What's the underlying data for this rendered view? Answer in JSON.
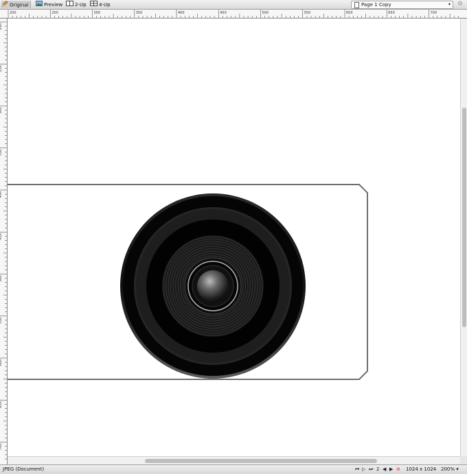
{
  "toolbar": {
    "tabs": [
      {
        "label": "Original",
        "icon": "pencil-icon",
        "active": true
      },
      {
        "label": "Preview",
        "icon": "preview-icon",
        "active": false
      },
      {
        "label": "2-Up",
        "icon": "two-up-icon",
        "active": false
      },
      {
        "label": "4-Up",
        "icon": "four-up-icon",
        "active": false
      }
    ],
    "page_select": "Page 1 Copy",
    "settings_icon": "settings-icon"
  },
  "ruler": {
    "top_labels": [
      "200",
      "250",
      "300",
      "350",
      "400",
      "450",
      "500",
      "550",
      "600",
      "650",
      "700",
      "750",
      "800"
    ],
    "left_labels": [
      "200",
      "250",
      "300",
      "350",
      "400",
      "450",
      "500",
      "550",
      "600",
      "650",
      "700"
    ]
  },
  "status": {
    "format": "JPEG (Document)",
    "page_number": "2",
    "dimensions": "1024 x 1024",
    "zoom": "200%"
  },
  "colors": {
    "lens_dark": "#050505",
    "lens_ring": "#262626",
    "outline": "#6e6e6e"
  }
}
